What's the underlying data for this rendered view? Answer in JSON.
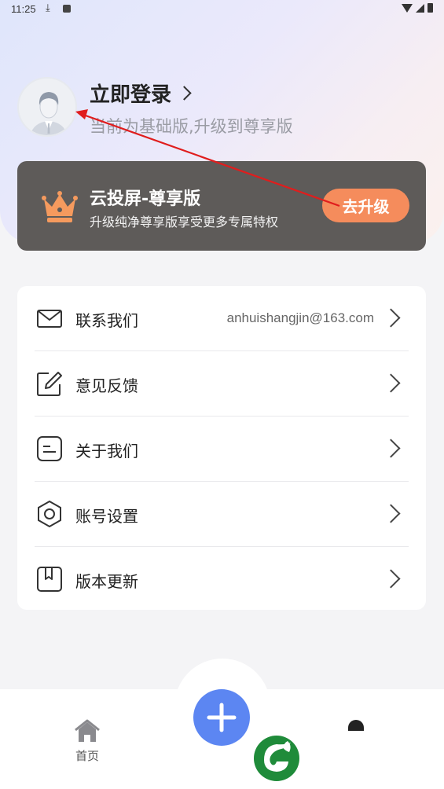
{
  "status_bar": {
    "time": "11:25"
  },
  "profile": {
    "login_title": "立即登录",
    "subtitle": "当前为基础版,升级到尊享版"
  },
  "vip": {
    "title": "云投屏-尊享版",
    "subtitle": "升级纯净尊享版享受更多专属特权",
    "button": "去升级"
  },
  "menu": {
    "items": [
      {
        "label": "联系我们",
        "value": "anhuishangjin@163.com",
        "icon": "mail-icon"
      },
      {
        "label": "意见反馈",
        "value": "",
        "icon": "edit-icon"
      },
      {
        "label": "关于我们",
        "value": "",
        "icon": "info-card-icon"
      },
      {
        "label": "账号设置",
        "value": "",
        "icon": "hexagon-settings-icon"
      },
      {
        "label": "版本更新",
        "value": "",
        "icon": "bookmark-icon"
      }
    ]
  },
  "bottom_nav": {
    "home_label": "首页"
  },
  "colors": {
    "accent": "#5c86f2",
    "upgrade": "#f58c5c",
    "vip_bg": "#5e5b59"
  }
}
